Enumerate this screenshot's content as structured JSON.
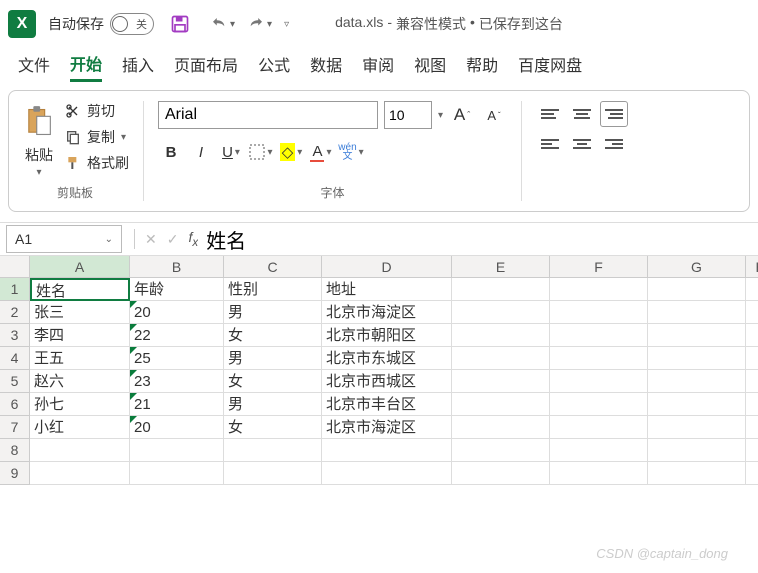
{
  "titlebar": {
    "autosave_label": "自动保存",
    "autosave_state": "关",
    "filename": "data.xls",
    "mode": "兼容性模式",
    "saved_status": "已保存到这台"
  },
  "tabs": {
    "file": "文件",
    "home": "开始",
    "insert": "插入",
    "page_layout": "页面布局",
    "formulas": "公式",
    "data": "数据",
    "review": "审阅",
    "view": "视图",
    "help": "帮助",
    "baidu": "百度网盘"
  },
  "ribbon": {
    "paste": "粘贴",
    "cut": "剪切",
    "copy": "复制",
    "format_painter": "格式刷",
    "clipboard_group": "剪贴板",
    "font_name": "Arial",
    "font_size": "10",
    "font_group": "字体"
  },
  "namebox": {
    "ref": "A1",
    "formula_value": "姓名"
  },
  "sheet": {
    "cols": [
      "A",
      "B",
      "C",
      "D",
      "E",
      "F",
      "G",
      "H"
    ],
    "rows": [
      [
        "姓名",
        "年龄",
        "性别",
        "地址",
        "",
        "",
        "",
        ""
      ],
      [
        "张三",
        "20",
        "男",
        "北京市海淀区",
        "",
        "",
        "",
        ""
      ],
      [
        "李四",
        "22",
        "女",
        "北京市朝阳区",
        "",
        "",
        "",
        ""
      ],
      [
        "王五",
        "25",
        "男",
        "北京市东城区",
        "",
        "",
        "",
        ""
      ],
      [
        "赵六",
        "23",
        "女",
        "北京市西城区",
        "",
        "",
        "",
        ""
      ],
      [
        "孙七",
        "21",
        "男",
        "北京市丰台区",
        "",
        "",
        "",
        ""
      ],
      [
        "小红",
        "20",
        "女",
        "北京市海淀区",
        "",
        "",
        "",
        ""
      ],
      [
        "",
        "",
        "",
        "",
        "",
        "",
        "",
        ""
      ],
      [
        "",
        "",
        "",
        "",
        "",
        "",
        "",
        ""
      ]
    ]
  },
  "watermark": "CSDN @captain_dong"
}
